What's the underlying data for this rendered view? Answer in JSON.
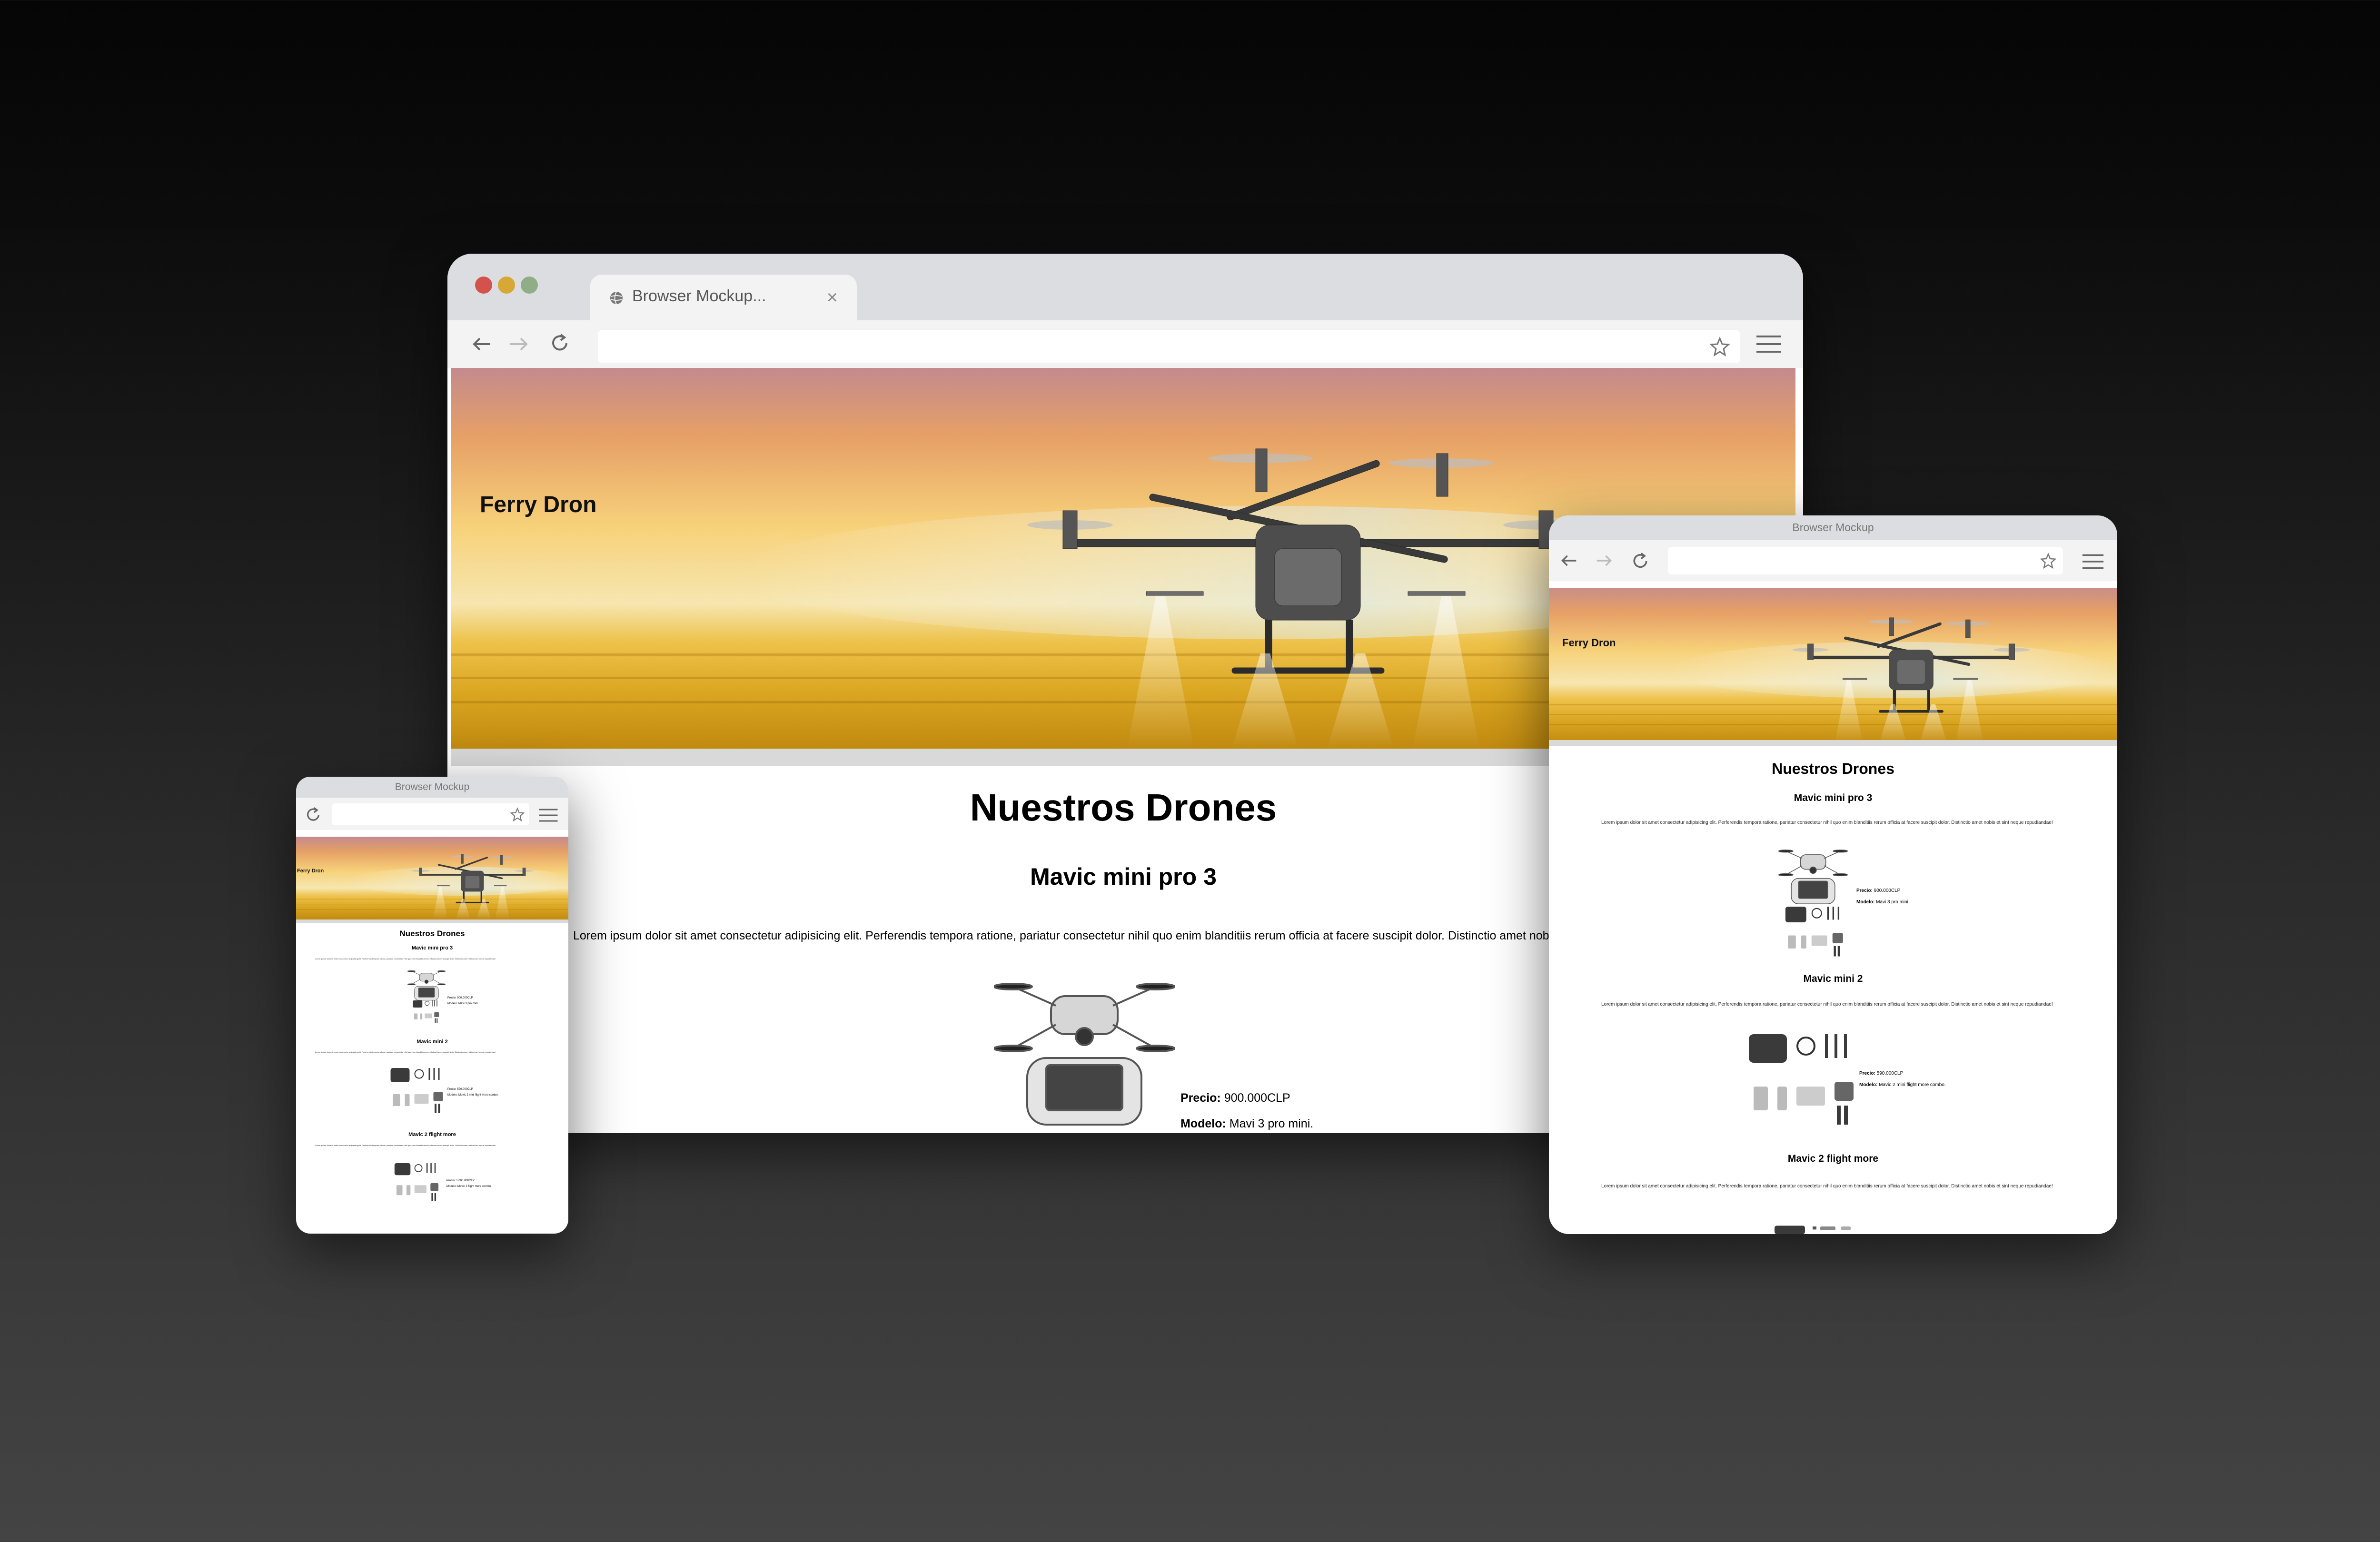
{
  "colors": {
    "traffic_red": "#d4524c",
    "traffic_yellow": "#d8a836",
    "traffic_green": "#8fae87",
    "chrome_gray": "#dcdde0",
    "toolbar_gray": "#f3f3f4"
  },
  "desktop": {
    "tab_title": "Browser Mockup...",
    "tab_close": "×",
    "site_title": "Ferry Dron",
    "heading": "Nuestros Drones",
    "product_title": "Mavic mini pro 3",
    "paragraph": "Lorem ipsum dolor sit amet consectetur adipisicing elit. Perferendis tempora ratione, pariatur consectetur nihil quo enim blanditiis rerum officia at facere suscipit dolor. Distinctio amet nobis et sint neque repudiandae!",
    "price_label": "Precio:",
    "price_value": " 900.000CLP",
    "model_label": "Modelo:",
    "model_value": " Mavi 3 pro mini."
  },
  "tablet": {
    "window_title": "Browser Mockup",
    "site_title": "Ferry Dron",
    "heading": "Nuestros Drones",
    "products": [
      {
        "title": "Mavic mini pro 3",
        "paragraph": "Lorem ipsum dolor sit amet consectetur adipisicing elit. Perferendis tempora ratione, pariatur consectetur nihil quo enim blanditiis rerum officia at facere suscipit dolor. Distinctio amet nobis et sint neque repudiandae!",
        "price_label": "Precio:",
        "price_value": " 900.000CLP",
        "model_label": "Modelo:",
        "model_value": " Mavi 3 pro mini."
      },
      {
        "title": "Mavic mini 2",
        "paragraph": "Lorem ipsum dolor sit amet consectetur adipisicing elit. Perferendis tempora ratione, pariatur consectetur nihil quo enim blanditiis rerum officia at facere suscipit dolor. Distinctio amet nobis et sint neque repudiandae!",
        "price_label": "Precio:",
        "price_value": " 590.000CLP",
        "model_label": "Modelo:",
        "model_value": " Mavic 2 mini flight more combo."
      },
      {
        "title": "Mavic 2 flight more",
        "paragraph": "Lorem ipsum dolor sit amet consectetur adipisicing elit. Perferendis tempora ratione, pariatur consectetur nihil quo enim blanditiis rerum officia at facere suscipit dolor. Distinctio amet nobis et sint neque repudiandae!"
      }
    ]
  },
  "phone": {
    "window_title": "Browser Mockup",
    "site_title": "Ferry Dron",
    "heading": "Nuestros Drones",
    "products": [
      {
        "title": "Mavic mini pro 3",
        "paragraph": "Lorem ipsum dolor sit amet consectetur adipisicing elit. Perferendis tempora ratione, pariatur consectetur nihil quo enim blanditiis rerum officia at facere suscipit dolor. Distinctio amet nobis et sint neque repudiandae!",
        "price": "Precio: 900.000CLP",
        "model": "Modelo: Mavi 3 pro mini."
      },
      {
        "title": "Mavic mini 2",
        "paragraph": "Lorem ipsum dolor sit amet consectetur adipisicing elit. Perferendis tempora ratione, pariatur consectetur nihil quo enim blanditiis rerum officia at facere suscipit dolor. Distinctio amet nobis et sint neque repudiandae!",
        "price": "Precio: 590.000CLP",
        "model": "Modelo: Mavic 2 mini flight more combo."
      },
      {
        "title": "Mavic 2 flight more",
        "paragraph": "Lorem ipsum dolor sit amet consectetur adipisicing elit. Perferendis tempora ratione, pariatur consectetur nihil quo enim blanditiis rerum officia at facere suscipit dolor. Distinctio amet nobis et sint neque repudiandae!",
        "price": "Precio: 1.000.000CLP",
        "model": "Modelo: Mavic 2 flight more combo."
      }
    ]
  },
  "icons": {
    "back": "back-arrow-icon",
    "forward": "forward-arrow-icon",
    "reload": "reload-icon",
    "star": "bookmark-star-icon",
    "menu": "hamburger-menu-icon",
    "globe": "globe-icon",
    "close": "close-icon"
  }
}
